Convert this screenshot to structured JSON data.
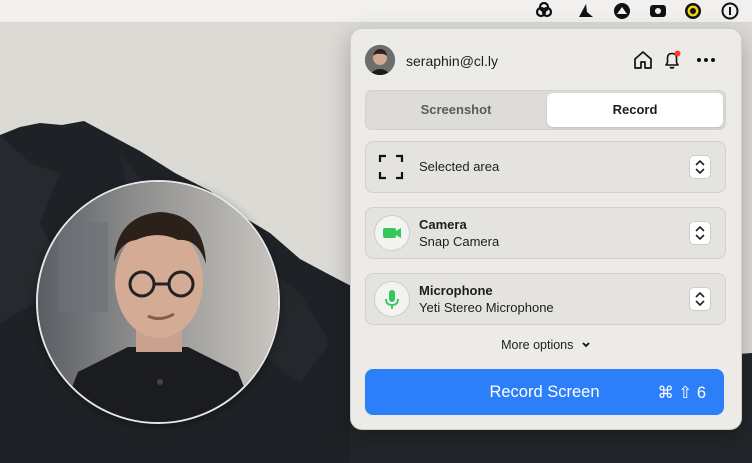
{
  "menubar": {
    "icons": [
      "creative-cloud-icon",
      "bird-icon",
      "arrow-up-icon",
      "camera-icon",
      "ring-icon",
      "onepassword-icon"
    ]
  },
  "account": {
    "email": "seraphin@cl.ly"
  },
  "header_icons": [
    "home-icon",
    "bell-icon",
    "more-icon"
  ],
  "tabs": [
    {
      "label": "Screenshot",
      "active": false
    },
    {
      "label": "Record",
      "active": true
    }
  ],
  "area": {
    "label": "Selected area",
    "icon": "selection-icon"
  },
  "camera": {
    "title": "Camera",
    "device": "Snap Camera",
    "icon": "video-camera-icon",
    "color": "#34c759"
  },
  "microphone": {
    "title": "Microphone",
    "device": "Yeti Stereo Microphone",
    "icon": "microphone-icon",
    "color": "#34c759"
  },
  "more_options": {
    "label": "More options"
  },
  "record": {
    "label": "Record Screen",
    "shortcut": "⌘ ⇧ 6",
    "color": "#2d7ff9"
  }
}
